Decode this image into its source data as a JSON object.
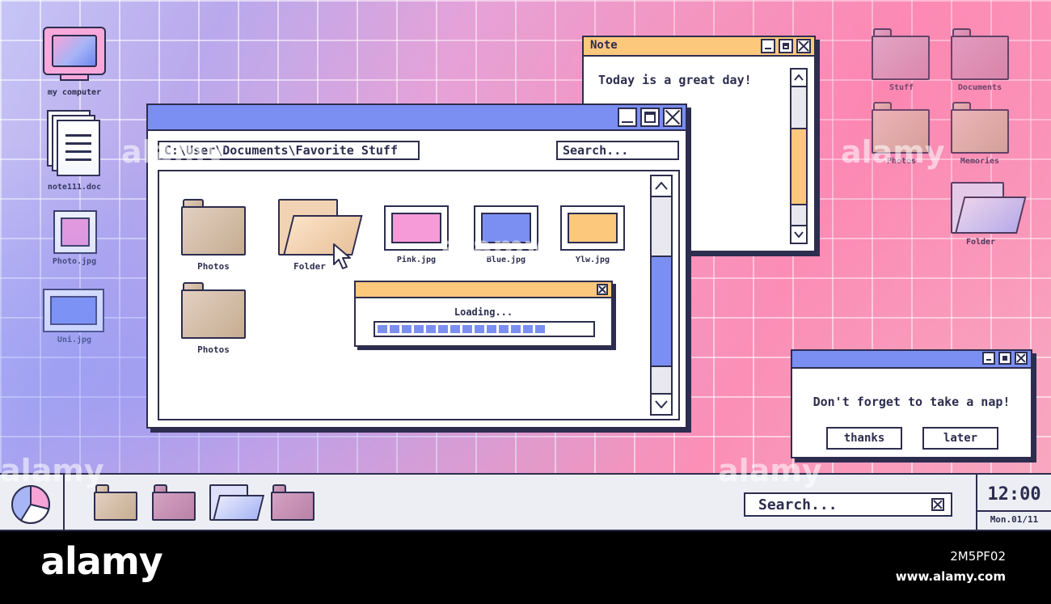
{
  "desktop": {
    "left_icons": [
      {
        "label": "my computer"
      },
      {
        "label": "note111.doc"
      },
      {
        "label": "Photo.jpg",
        "color": "#f79ad8"
      },
      {
        "label": "Uni.jpg",
        "color": "#7b8ff2"
      }
    ],
    "right_icons": [
      {
        "label": "Stuff"
      },
      {
        "label": "Documents"
      },
      {
        "label": "Photos"
      },
      {
        "label": "Memories"
      },
      {
        "label": "Folder"
      }
    ]
  },
  "explorer": {
    "path": "C:\\User\\Documents\\Favorite Stuff",
    "search_placeholder": "Search...",
    "items": [
      {
        "label": "Photos",
        "kind": "folder"
      },
      {
        "label": "Folder",
        "kind": "open-folder"
      },
      {
        "label": "Pink.jpg",
        "kind": "image",
        "color": "#f79ad8"
      },
      {
        "label": "Blue.jpg",
        "kind": "image",
        "color": "#7b8ff2"
      },
      {
        "label": "Ylw.jpg",
        "kind": "image",
        "color": "#fcc87c"
      },
      {
        "label": "Photos",
        "kind": "folder"
      }
    ]
  },
  "loading": {
    "text": "Loading...",
    "progress_fraction": 0.74,
    "segments_filled": 14
  },
  "note": {
    "title": "Note",
    "text": "Today is a great day!"
  },
  "dialog": {
    "message": "Don't forget to take a nap!",
    "thanks_label": "thanks",
    "later_label": "later"
  },
  "taskbar": {
    "search_placeholder": "Search...",
    "time": "12:00",
    "date": "Mon.01/11"
  },
  "watermark": {
    "brand": "alamy",
    "image_id": "2M5PF02",
    "site": "www.alamy.com"
  },
  "colors": {
    "accent_blue": "#7b8ff2",
    "accent_orange": "#fcc87c",
    "accent_pink": "#f79ad8",
    "outline": "#2d2d4f"
  }
}
